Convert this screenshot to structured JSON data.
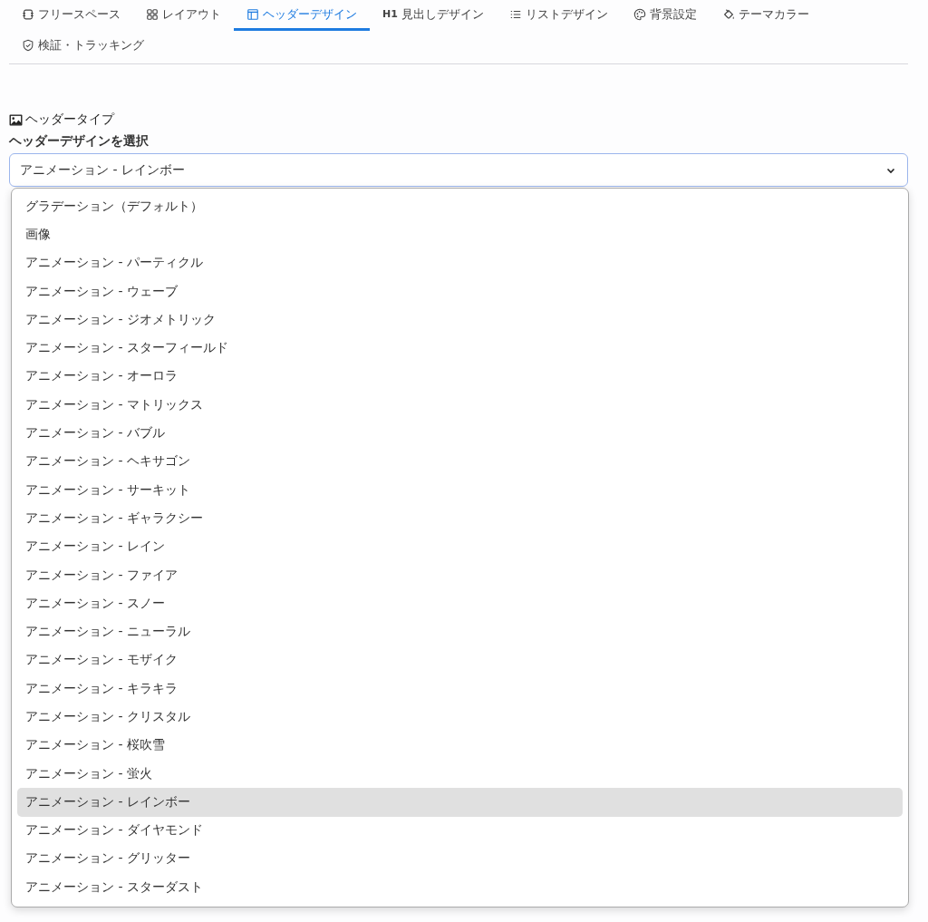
{
  "tabs": [
    {
      "label": "フリースペース",
      "kind": "frame",
      "selected": false
    },
    {
      "label": "レイアウト",
      "kind": "grid",
      "selected": false
    },
    {
      "label": "ヘッダーデザイン",
      "kind": "layout",
      "selected": true
    },
    {
      "label": "見出しデザイン",
      "kind": "h1",
      "icon_text": "H1",
      "selected": false
    },
    {
      "label": "リストデザイン",
      "kind": "list",
      "selected": false
    },
    {
      "label": "背景設定",
      "kind": "palette",
      "selected": false
    },
    {
      "label": "テーマカラー",
      "kind": "bucket",
      "selected": false
    },
    {
      "label": "検証・トラッキング",
      "kind": "shield",
      "selected": false
    }
  ],
  "section": {
    "title": "ヘッダータイプ",
    "field_label": "ヘッダーデザインを選択",
    "value": "アニメーション - レインボー"
  },
  "options": [
    {
      "label": "グラデーション（デフォルト）",
      "selected": false
    },
    {
      "label": "画像",
      "selected": false
    },
    {
      "label": "アニメーション - パーティクル",
      "selected": false
    },
    {
      "label": "アニメーション - ウェーブ",
      "selected": false
    },
    {
      "label": "アニメーション - ジオメトリック",
      "selected": false
    },
    {
      "label": "アニメーション - スターフィールド",
      "selected": false
    },
    {
      "label": "アニメーション - オーロラ",
      "selected": false
    },
    {
      "label": "アニメーション - マトリックス",
      "selected": false
    },
    {
      "label": "アニメーション - バブル",
      "selected": false
    },
    {
      "label": "アニメーション - ヘキサゴン",
      "selected": false
    },
    {
      "label": "アニメーション - サーキット",
      "selected": false
    },
    {
      "label": "アニメーション - ギャラクシー",
      "selected": false
    },
    {
      "label": "アニメーション - レイン",
      "selected": false
    },
    {
      "label": "アニメーション - ファイア",
      "selected": false
    },
    {
      "label": "アニメーション - スノー",
      "selected": false
    },
    {
      "label": "アニメーション - ニューラル",
      "selected": false
    },
    {
      "label": "アニメーション - モザイク",
      "selected": false
    },
    {
      "label": "アニメーション - キラキラ",
      "selected": false
    },
    {
      "label": "アニメーション - クリスタル",
      "selected": false
    },
    {
      "label": "アニメーション - 桜吹雪",
      "selected": false
    },
    {
      "label": "アニメーション - 蛍火",
      "selected": false
    },
    {
      "label": "アニメーション - レインボー",
      "selected": true
    },
    {
      "label": "アニメーション - ダイヤモンド",
      "selected": false
    },
    {
      "label": "アニメーション - グリッター",
      "selected": false
    },
    {
      "label": "アニメーション - スターダスト",
      "selected": false
    }
  ]
}
